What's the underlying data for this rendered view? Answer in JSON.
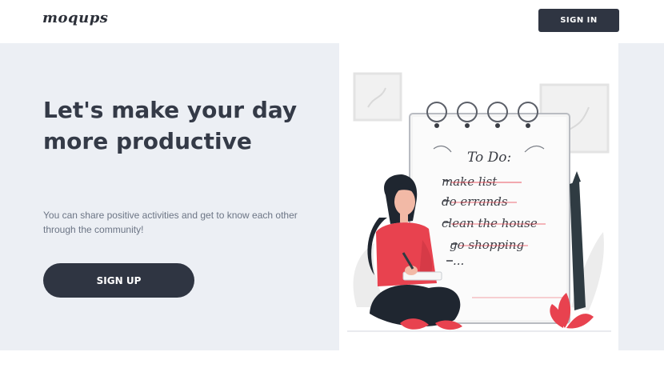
{
  "header": {
    "logo_text": "moqups",
    "signin_label": "SIGN IN"
  },
  "hero": {
    "headline": "Let's make your day more productive",
    "subtext": "You can share positive activities and get to know each other through the community!",
    "signup_label": "SIGN UP"
  },
  "illustration": {
    "todo_title": "To Do:",
    "todo_items": [
      "make list",
      "do errands",
      "clean the house",
      "go shopping",
      "..."
    ]
  },
  "colors": {
    "dark": "#2f3542",
    "hero_bg": "#eceff4",
    "accent_red": "#e8424f"
  }
}
